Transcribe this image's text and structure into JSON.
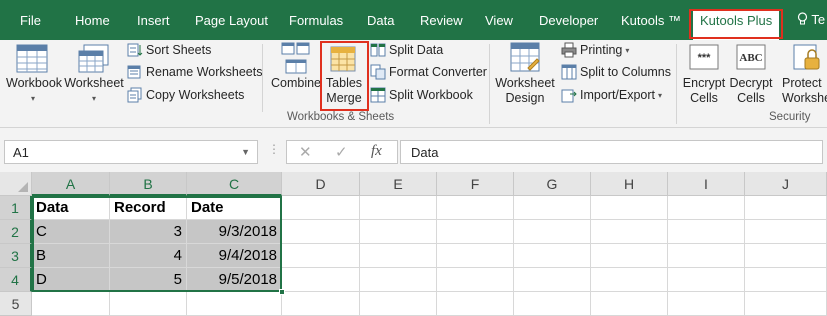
{
  "tabs": [
    "File",
    "Home",
    "Insert",
    "Page Layout",
    "Formulas",
    "Data",
    "Review",
    "View",
    "Developer",
    "Kutools ™",
    "Kutools Plus",
    "Te"
  ],
  "active_tab": "Kutools Plus",
  "ribbon": {
    "workbook": "Workbook",
    "worksheet": "Worksheet",
    "sort_sheets": "Sort Sheets",
    "rename_worksheets": "Rename Worksheets",
    "copy_worksheets": "Copy Worksheets",
    "combine": "Combine",
    "tables_line1": "Tables",
    "tables_line2": "Merge",
    "split_data": "Split Data",
    "format_converter": "Format Converter",
    "split_workbook": "Split Workbook",
    "group_workbooks": "Workbooks & Sheets",
    "worksheet_design_line1": "Worksheet",
    "worksheet_design_line2": "Design",
    "printing": "Printing",
    "split_to_columns": "Split to Columns",
    "import_export": "Import/Export",
    "encrypt_line1": "Encrypt",
    "encrypt_line2": "Cells",
    "decrypt_line1": "Decrypt",
    "decrypt_line2": "Cells",
    "protect_line1": "Protect",
    "protect_line2": "Workshe",
    "group_security": "Security",
    "encrypt_icon_text": "***",
    "decrypt_icon_text": "ABC"
  },
  "formula_bar": {
    "name_box": "A1",
    "cancel_symbol": "✕",
    "enter_symbol": "✓",
    "fx_symbol": "fx",
    "formula": "Data"
  },
  "columns": [
    "A",
    "B",
    "C",
    "D",
    "E",
    "F",
    "G",
    "H",
    "I",
    "J"
  ],
  "rows": [
    "1",
    "2",
    "3",
    "4",
    "5"
  ],
  "table": [
    [
      "Data",
      "Record",
      "Date"
    ],
    [
      "C",
      "3",
      "9/3/2018"
    ],
    [
      "B",
      "4",
      "9/4/2018"
    ],
    [
      "D",
      "5",
      "9/5/2018"
    ]
  ],
  "colors": {
    "excel_green": "#217346",
    "highlight_red": "#e0301e"
  }
}
